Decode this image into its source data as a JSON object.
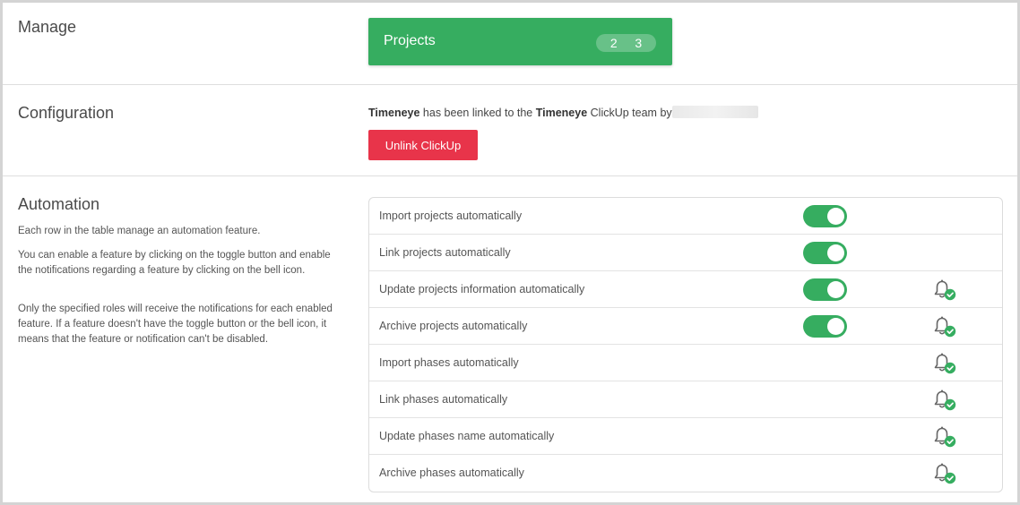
{
  "manage": {
    "title": "Manage",
    "projects": {
      "label": "Projects",
      "count_a": "2",
      "count_b": "3"
    }
  },
  "configuration": {
    "title": "Configuration",
    "link_app": "Timeneye",
    "link_mid": " has been linked to the ",
    "link_team": "Timeneye",
    "link_end": " ClickUp team by",
    "unlink_label": "Unlink ClickUp"
  },
  "automation": {
    "title": "Automation",
    "desc1": "Each row in the table manage an automation feature.",
    "desc2": "You can enable a feature by clicking on the toggle button and enable the notifications regarding a feature by clicking on the bell icon.",
    "desc3": "Only the specified roles will receive the notifications for each enabled feature. If a feature doesn't have the toggle button or the bell icon, it means that the feature or notification can't be disabled.",
    "rows": [
      {
        "label": "Import projects automatically"
      },
      {
        "label": "Link projects automatically"
      },
      {
        "label": "Update projects information automatically"
      },
      {
        "label": "Archive projects automatically"
      },
      {
        "label": "Import phases automatically"
      },
      {
        "label": "Link phases automatically"
      },
      {
        "label": "Update phases name automatically"
      },
      {
        "label": "Archive phases automatically"
      }
    ]
  },
  "colors": {
    "accent_green": "#36ad60",
    "danger_red": "#e8344a"
  },
  "icons": {
    "toggle": "toggle-on",
    "bell": "bell-check-icon"
  }
}
